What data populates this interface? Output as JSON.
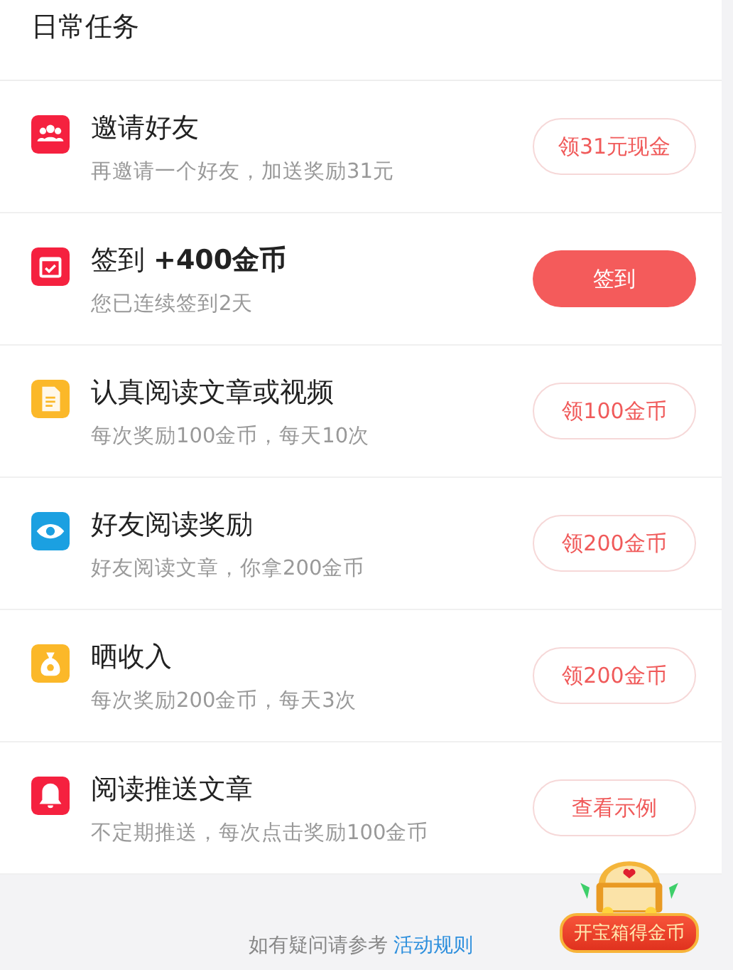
{
  "header": {
    "title": "日常任务"
  },
  "tasks": [
    {
      "title": "邀请好友",
      "subtitle": "再邀请一个好友，加送奖励31元",
      "color": "#f5213f",
      "button": {
        "label": "领31元现金",
        "kind": "outline"
      }
    },
    {
      "title": "签到 **+400金币**",
      "subtitle": "您已连续签到2天",
      "color": "#f5213f",
      "button": {
        "label": "签到",
        "kind": "filled"
      }
    },
    {
      "title": "认真阅读文章或视频",
      "subtitle": "每次奖励100金币，每天10次",
      "color": "#fbb829",
      "button": {
        "label": "领100金币",
        "kind": "outline"
      }
    },
    {
      "title": "好友阅读奖励",
      "subtitle": "好友阅读文章，你拿200金币",
      "color": "#1ba0e1",
      "button": {
        "label": "领200金币",
        "kind": "outline"
      }
    },
    {
      "title": "晒收入",
      "subtitle": "每次奖励200金币，每天3次",
      "color": "#fbb829",
      "button": {
        "label": "领200金币",
        "kind": "outline"
      }
    },
    {
      "title": "阅读推送文章",
      "subtitle": "不定期推送，每次点击奖励100金币",
      "color": "#f5213f",
      "button": {
        "label": "查看示例",
        "kind": "outline"
      }
    }
  ],
  "footer": {
    "text": "如有疑问请参考",
    "link": "活动规则"
  },
  "treasure_chest": {
    "label": "开宝箱得金币"
  }
}
